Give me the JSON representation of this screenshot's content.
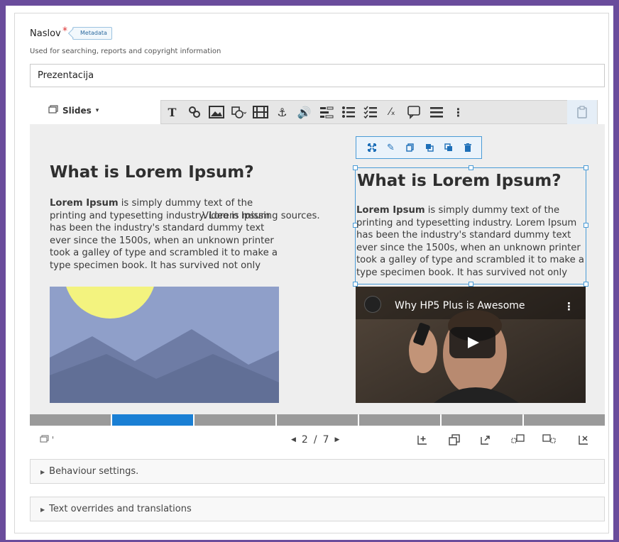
{
  "field": {
    "label": "Naslov",
    "required_mark": "*",
    "metadata_label": "Metadata",
    "help_text": "Used for searching, reports and copyright information",
    "value": "Prezentacija"
  },
  "editor": {
    "slides_menu_label": "Slides",
    "toolbar_icons": [
      "text-icon",
      "link-icon",
      "image-icon",
      "shapes-icon",
      "video-icon",
      "anchor-icon",
      "audio-icon",
      "chart-icon",
      "list-icon",
      "checklist-icon",
      "fraction-icon",
      "speech-bubble-icon",
      "lines-icon",
      "more-icon",
      "paste-icon"
    ]
  },
  "slide": {
    "left_heading": "What is Lorem Ipsum?",
    "left_bold": "Lorem Ipsum",
    "left_body": " is simply dummy text of the printing and typesetting industry. Lorem Ipsum has been the industry's standard dummy text ever since the 1500s, when an unknown printer took a galley of type and scrambled it to make a type specimen book. It has survived not only",
    "overlay_text": "Video is missing sources.",
    "right_heading": "What is Lorem Ipsum?",
    "right_bold": "Lorem Ipsum",
    "right_body": " is simply dummy text of the printing and typesetting industry. Lorem Ipsum has been the industry's standard dummy text ever since the 1500s, when an unknown printer took a galley of type and scrambled it to make a type specimen book. It has survived not only",
    "video_title": "Why HP5 Plus is Awesome",
    "video_more": "⋮"
  },
  "progress": {
    "segments": 7,
    "active": 2
  },
  "footer": {
    "slides_label": "'",
    "current": "2",
    "sep": "/",
    "total": "7"
  },
  "accordions": {
    "behaviour": "Behaviour settings.",
    "text_overrides": "Text overrides and translations"
  },
  "colors": {
    "accent": "#1a7fd4",
    "frame": "#6a4c9c",
    "required": "#dd3333",
    "sun": "#f3f37f",
    "sky": "#8f9fc9"
  }
}
